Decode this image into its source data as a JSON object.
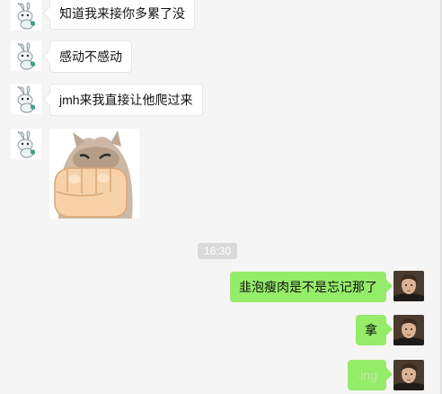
{
  "messages_in": [
    {
      "text": "知道我来接你多累了没"
    },
    {
      "text": "感动不感动"
    },
    {
      "text": "jmh来我直接让他爬过来"
    }
  ],
  "sticker": {
    "icon": "fist-cat-sticker-icon"
  },
  "timestamp": "16:30",
  "messages_out": [
    {
      "text": "韭泡瘦肉是不是忘记那了"
    },
    {
      "text": "拿"
    },
    {
      "text": "·ing"
    }
  ],
  "icons": {
    "left_avatar": "rabbit-avatar-icon",
    "right_avatar": "person-avatar-icon"
  },
  "colors": {
    "background": "#f5f5f5",
    "bubble_in": "#ffffff",
    "bubble_out": "#95ec69",
    "time_badge": "#dadada"
  }
}
